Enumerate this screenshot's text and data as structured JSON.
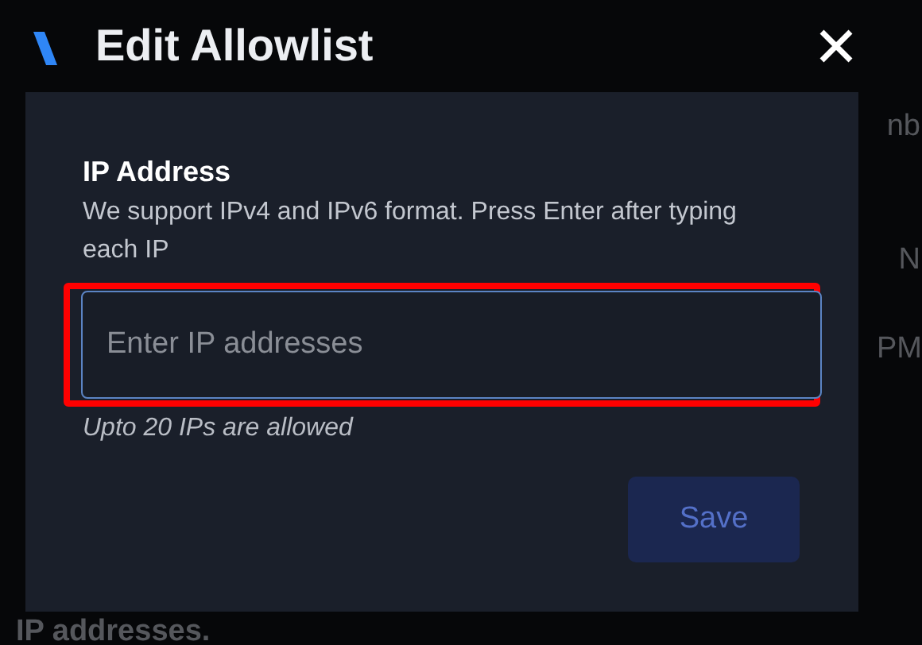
{
  "background_texts": [
    "nb",
    "N",
    "PM",
    "IP addresses."
  ],
  "dialog": {
    "title": "Edit Allowlist",
    "field": {
      "label": "IP Address",
      "description": "We support IPv4 and IPv6 format. Press Enter after typing each IP",
      "placeholder": "Enter IP addresses",
      "hint": "Upto 20 IPs are allowed",
      "highlighted": true
    },
    "save_button": {
      "label": "Save",
      "disabled": true
    }
  }
}
